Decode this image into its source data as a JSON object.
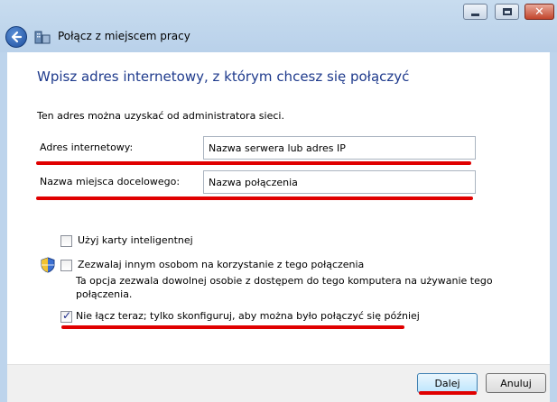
{
  "window": {
    "title": "Połącz z miejscem pracy",
    "controls": {
      "minimize_icon": "minimize-icon",
      "maximize_icon": "maximize-icon",
      "close_icon": "close-icon",
      "close_glyph": "✕"
    }
  },
  "main": {
    "heading": "Wpisz adres internetowy, z którym chcesz się połączyć",
    "description": "Ten adres można uzyskać od administratora sieci.",
    "address": {
      "label": "Adres internetowy:",
      "placeholder": "Nazwa serwera lub adres IP",
      "value": ""
    },
    "destination": {
      "label": "Nazwa miejsca docelowego:",
      "placeholder": "Nazwa połączenia",
      "value": ""
    },
    "options": [
      {
        "label": "Użyj karty inteligentnej",
        "checked": false
      },
      {
        "label": "Zezwalaj innym osobom na korzystanie z tego połączenia",
        "checked": false,
        "help": "Ta opcja zezwala dowolnej osobie z dostępem do tego komputera na używanie tego połączenia."
      },
      {
        "label": "Nie łącz teraz; tylko skonfiguruj, aby można było połączyć się później",
        "checked": true
      }
    ]
  },
  "footer": {
    "next_label": "Dalej",
    "cancel_label": "Anuluj"
  },
  "colors": {
    "heading": "#1e3a8c",
    "annotation": "#e00000",
    "chrome": "#bdd4ec"
  }
}
